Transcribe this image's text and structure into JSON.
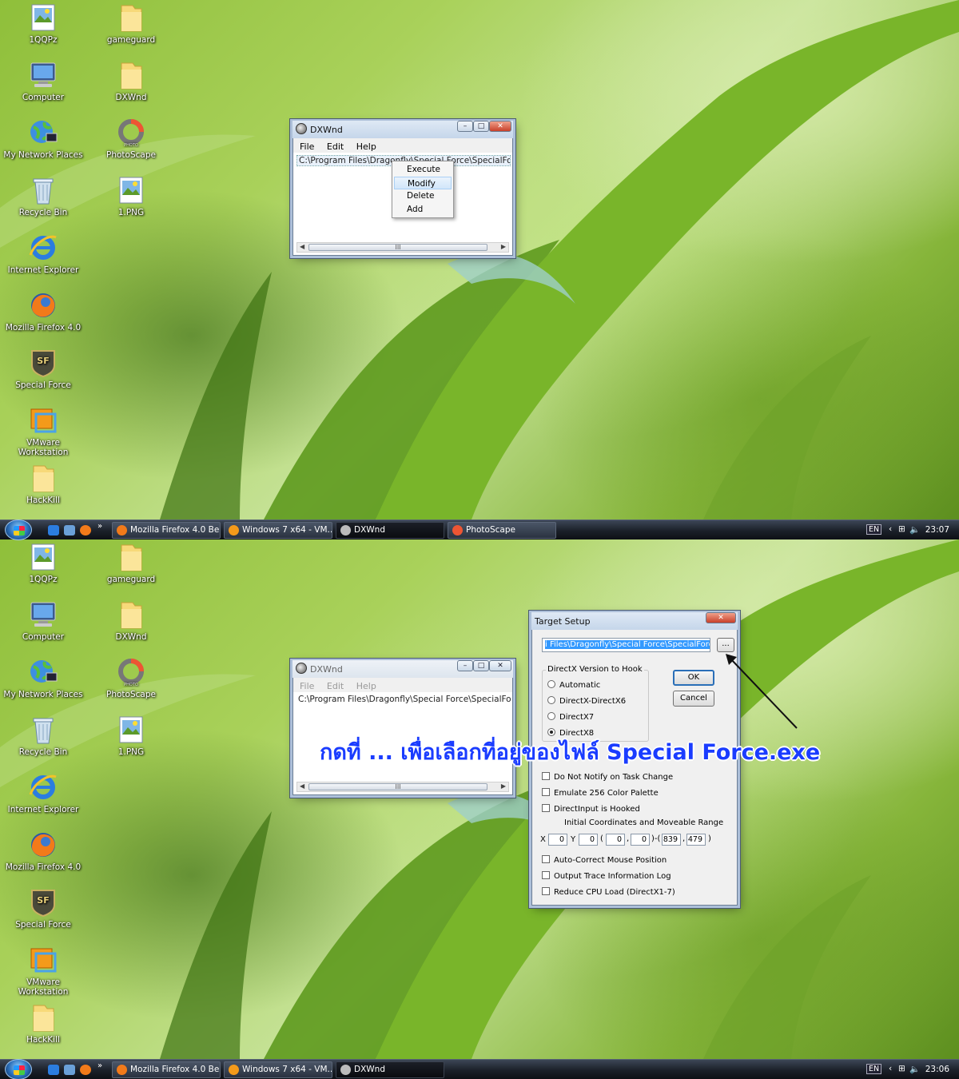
{
  "desktop": {
    "icons_left": [
      {
        "label": "1QQPz",
        "icon": "image-file-icon"
      },
      {
        "label": "Computer",
        "icon": "computer-icon"
      },
      {
        "label": "My Network Places",
        "icon": "network-globe-icon"
      },
      {
        "label": "Recycle Bin",
        "icon": "recycle-bin-icon"
      },
      {
        "label": "Internet Explorer",
        "icon": "internet-explorer-icon"
      },
      {
        "label": "Mozilla Firefox 4.0",
        "icon": "firefox-icon"
      },
      {
        "label": "Special Force",
        "icon": "special-force-icon"
      },
      {
        "label": "VMware Workstation",
        "icon": "vmware-icon"
      },
      {
        "label": "HackKill",
        "icon": "folder-icon"
      }
    ],
    "icons_right": [
      {
        "label": "gameguard",
        "icon": "folder-icon"
      },
      {
        "label": "DXWnd",
        "icon": "folder-icon"
      },
      {
        "label": "PhotoScape",
        "icon": "photoscape-icon"
      },
      {
        "label": "1.PNG",
        "icon": "image-file-icon"
      }
    ]
  },
  "taskbar_top": {
    "buttons": [
      {
        "label": "Mozilla Firefox 4.0 Be...",
        "active": false
      },
      {
        "label": "Windows 7 x64 - VM...",
        "active": false
      },
      {
        "label": "DXWnd",
        "active": true
      },
      {
        "label": "PhotoScape",
        "active": false
      }
    ],
    "language": "EN",
    "clock": "23:07"
  },
  "taskbar_bottom": {
    "buttons": [
      {
        "label": "Mozilla Firefox 4.0 Be...",
        "active": false
      },
      {
        "label": "Windows 7 x64 - VM...",
        "active": false
      },
      {
        "label": "DXWnd",
        "active": true
      }
    ],
    "language": "EN",
    "clock": "23:06"
  },
  "dxwnd": {
    "title": "DXWnd",
    "menu": [
      "File",
      "Edit",
      "Help"
    ],
    "list_item": "C:\\Program Files\\Dragonfly\\Special Force\\SpecialForce.exe",
    "scroll_grip": "III",
    "context_menu": [
      "Execute",
      "Modify",
      "Delete",
      "Add"
    ],
    "highlighted": "Modify"
  },
  "target_setup": {
    "title": "Target Setup",
    "path_value": "i Files\\Dragonfly\\Special Force\\SpecialForce.exe",
    "browse_label": "...",
    "ok_label": "OK",
    "cancel_label": "Cancel",
    "group_label": "DirectX Version to Hook",
    "radios": [
      "Automatic",
      "DirectX-DirectX6",
      "DirectX7",
      "DirectX8"
    ],
    "selected_radio": "DirectX8",
    "checkboxes_top": [
      "Do Not Notify on Task Change",
      "Emulate 256 Color Palette",
      "DirectInput is Hooked"
    ],
    "coords_label": "Initial Coordinates and Moveable Range",
    "x_label": "X",
    "y_label": "Y",
    "coords": [
      "0",
      "0",
      "0",
      "0",
      "839",
      "479"
    ],
    "checkboxes_bottom": [
      "Auto-Correct Mouse Position",
      "Output Trace Information Log",
      "Reduce CPU Load (DirectX1-7)"
    ]
  },
  "annotation": "กดที่ ... เพื่อเลือกที่อยู่ของไฟล์ Special Force.exe"
}
